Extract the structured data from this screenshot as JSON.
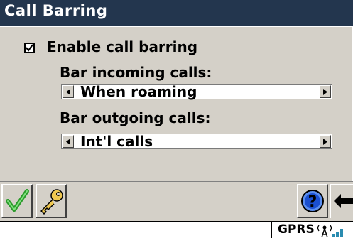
{
  "window": {
    "title": "Call Barring"
  },
  "settings": {
    "enable_label": "Enable call barring",
    "enable_checked": true,
    "incoming_label": "Bar incoming calls:",
    "incoming_value": "When roaming",
    "outgoing_label": "Bar outgoing calls:",
    "outgoing_value": "Int'l calls"
  },
  "toolbar": {
    "ok_icon": "checkmark-icon",
    "key_icon": "key-icon",
    "help_icon": "help-icon",
    "back_icon": "back-arrow-icon"
  },
  "status": {
    "network": "GPRS",
    "signal_icon": "signal-antenna-icon"
  },
  "colors": {
    "titlebar": "#23364e",
    "panel": "#d4d0c8",
    "check_green": "#2a9a2a",
    "help_blue": "#1a4fd0"
  }
}
